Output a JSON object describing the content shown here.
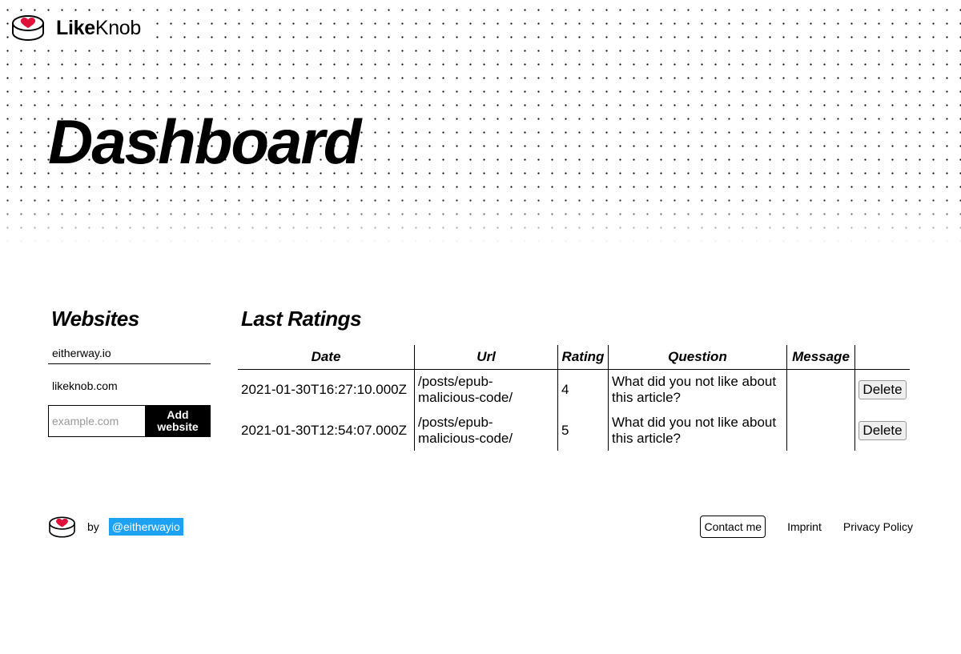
{
  "brand": {
    "name_bold": "Like",
    "name_regular": "Knob",
    "logo_icon": "heart-button-icon"
  },
  "page": {
    "title": "Dashboard"
  },
  "websites": {
    "title": "Websites",
    "items": [
      {
        "label": "eitherway.io",
        "active": true
      },
      {
        "label": "likeknob.com",
        "active": false
      }
    ],
    "add_placeholder": "example.com",
    "add_value": "",
    "add_button_label": "Add website"
  },
  "ratings": {
    "title": "Last Ratings",
    "columns": [
      "Date",
      "Url",
      "Rating",
      "Question",
      "Message",
      ""
    ],
    "rows": [
      {
        "date": "2021-01-30T16:27:10.000Z",
        "url": "/posts/epub-malicious-code/",
        "rating": "4",
        "question": "What did you not like about this article?",
        "message": "",
        "action": "Delete"
      },
      {
        "date": "2021-01-30T12:54:07.000Z",
        "url": "/posts/epub-malicious-code/",
        "rating": "5",
        "question": "What did you not like about this article?",
        "message": "",
        "action": "Delete"
      }
    ]
  },
  "footer": {
    "by": "by",
    "handle": "@eitherwayio",
    "links": {
      "contact": "Contact me",
      "imprint": "Imprint",
      "privacy": "Privacy Policy"
    }
  },
  "colors": {
    "accent_red": "#e0103b",
    "twitter_blue": "#1da1f2",
    "text": "#000000",
    "background": "#ffffff"
  }
}
